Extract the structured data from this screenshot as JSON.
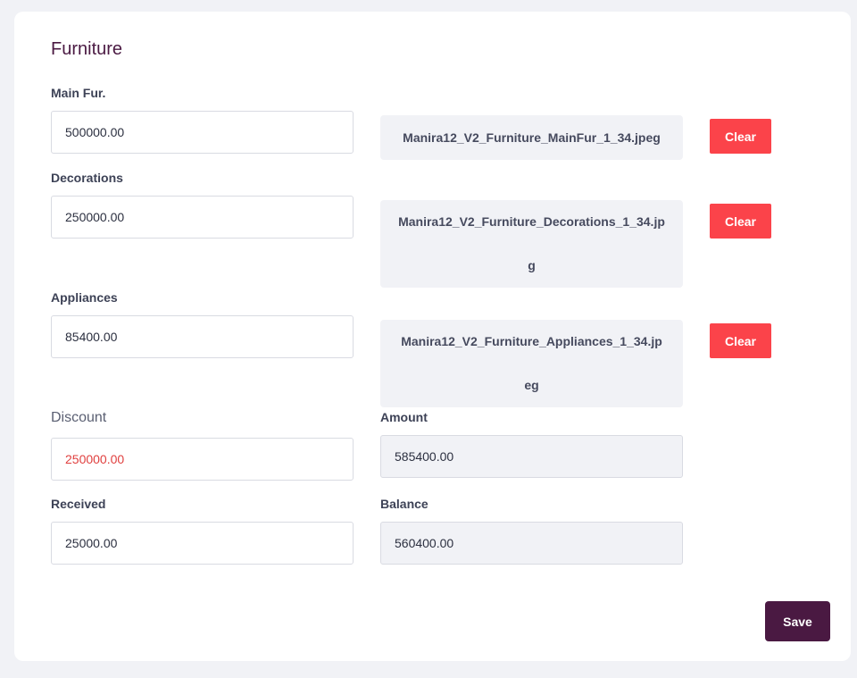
{
  "section": {
    "title": "Furniture"
  },
  "main_fur": {
    "label": "Main Fur.",
    "value": "500000.00",
    "file_name": "Manira12_V2_Furniture_MainFur_1_34.jpeg",
    "clear_label": "Clear"
  },
  "decorations": {
    "label": "Decorations",
    "value": "250000.00",
    "file_name": "Manira12_V2_Furniture_Decorations_1_34.jpg",
    "clear_label": "Clear"
  },
  "appliances": {
    "label": "Appliances",
    "value": "85400.00",
    "file_name": "Manira12_V2_Furniture_Appliances_1_34.jpeg",
    "clear_label": "Clear"
  },
  "discount": {
    "label": "Discount",
    "value": "250000.00"
  },
  "amount": {
    "label": "Amount",
    "value": "585400.00"
  },
  "received": {
    "label": "Received",
    "value": "25000.00"
  },
  "balance": {
    "label": "Balance",
    "value": "560400.00"
  },
  "actions": {
    "save_label": "Save"
  },
  "colors": {
    "accent": "#4a1942",
    "danger": "#fb434a",
    "discount_text": "#e0403f"
  }
}
